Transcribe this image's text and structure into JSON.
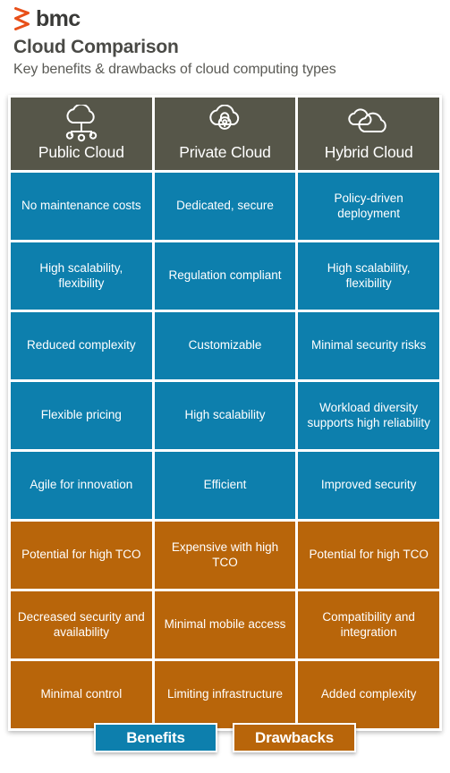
{
  "brand": {
    "logo_icon": "bmc-chevron-logo",
    "wordmark": "bmc",
    "logo_color": "#e8501a"
  },
  "header": {
    "title": "Cloud Comparison",
    "subtitle": "Key benefits & drawbacks of cloud computing types"
  },
  "theme": {
    "header_bg": "#565649",
    "benefit_color": "#0d7fad",
    "drawback_color": "#b8650a",
    "text_color": "#ffffff"
  },
  "table": {
    "columns": [
      {
        "label": "Public Cloud",
        "icon": "cloud-network-icon"
      },
      {
        "label": "Private Cloud",
        "icon": "cloud-lock-icon"
      },
      {
        "label": "Hybrid Cloud",
        "icon": "two-clouds-icon"
      }
    ],
    "rows": [
      {
        "type": "benefit",
        "cells": [
          "No maintenance costs",
          "Dedicated, secure",
          "Policy-driven deployment"
        ]
      },
      {
        "type": "benefit",
        "cells": [
          "High scalability, flexibility",
          "Regulation compliant",
          "High scalability, flexibility"
        ]
      },
      {
        "type": "benefit",
        "cells": [
          "Reduced complexity",
          "Customizable",
          "Minimal security risks"
        ]
      },
      {
        "type": "benefit",
        "cells": [
          "Flexible pricing",
          "High scalability",
          "Workload diversity supports high reliability"
        ]
      },
      {
        "type": "benefit",
        "cells": [
          "Agile for innovation",
          "Efficient",
          "Improved security"
        ]
      },
      {
        "type": "drawback",
        "cells": [
          "Potential for high TCO",
          "Expensive with high TCO",
          "Potential for high TCO"
        ]
      },
      {
        "type": "drawback",
        "cells": [
          "Decreased security and availability",
          "Minimal mobile access",
          "Compatibility and integration"
        ]
      },
      {
        "type": "drawback",
        "cells": [
          "Minimal control",
          "Limiting infrastructure",
          "Added complexity"
        ]
      }
    ]
  },
  "legend": {
    "items": [
      {
        "label": "Benefits",
        "type": "benefit"
      },
      {
        "label": "Drawbacks",
        "type": "drawback"
      }
    ]
  }
}
